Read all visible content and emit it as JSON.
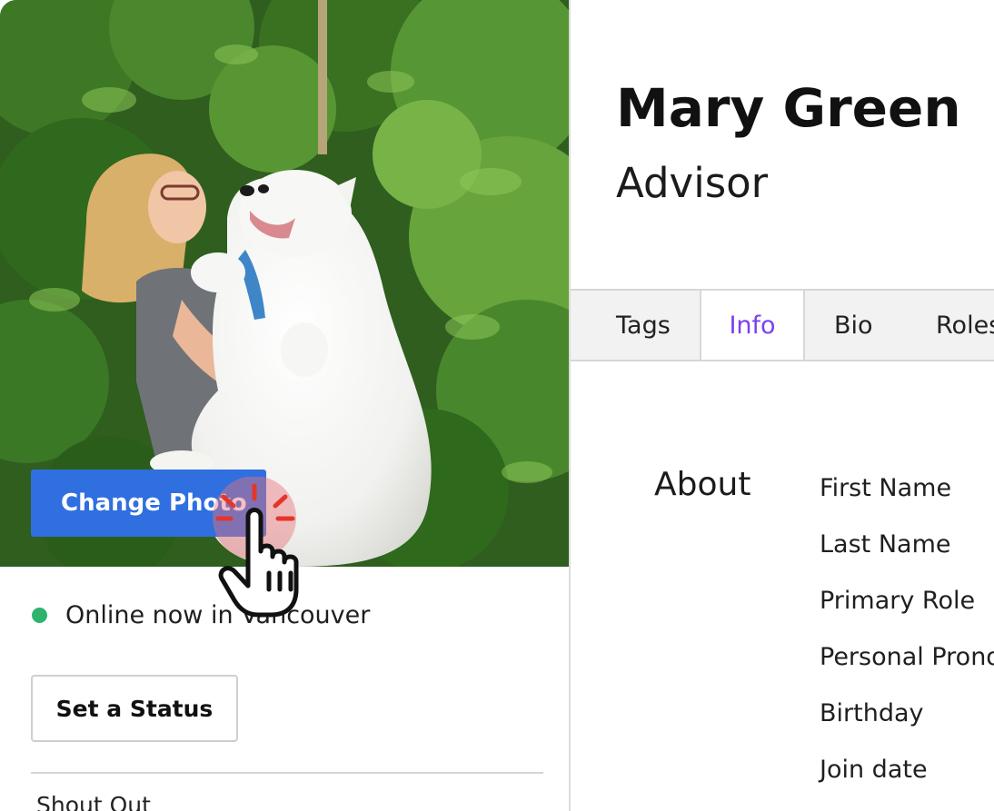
{
  "profile": {
    "name": "Mary Green",
    "role": "Advisor",
    "change_photo_label": "Change Photo",
    "status_text": "Online now in Vancouver",
    "set_status_label": "Set a Status",
    "shout_out_label": "Shout Out"
  },
  "tabs": [
    {
      "label": "Tags",
      "active": false
    },
    {
      "label": "Info",
      "active": true
    },
    {
      "label": "Bio",
      "active": false
    },
    {
      "label": "Roles",
      "active": false
    }
  ],
  "about": {
    "heading": "About",
    "fields": [
      "First Name",
      "Last Name",
      "Primary Role",
      "Personal Pronouns",
      "Birthday",
      "Join date"
    ]
  },
  "colors": {
    "accent_button": "#2f6fe0",
    "active_tab_text": "#7a3ff0",
    "online_dot": "#2fb36e"
  },
  "icons": [
    "pointer-hand-cursor-icon",
    "click-burst-icon",
    "online-dot-icon"
  ]
}
